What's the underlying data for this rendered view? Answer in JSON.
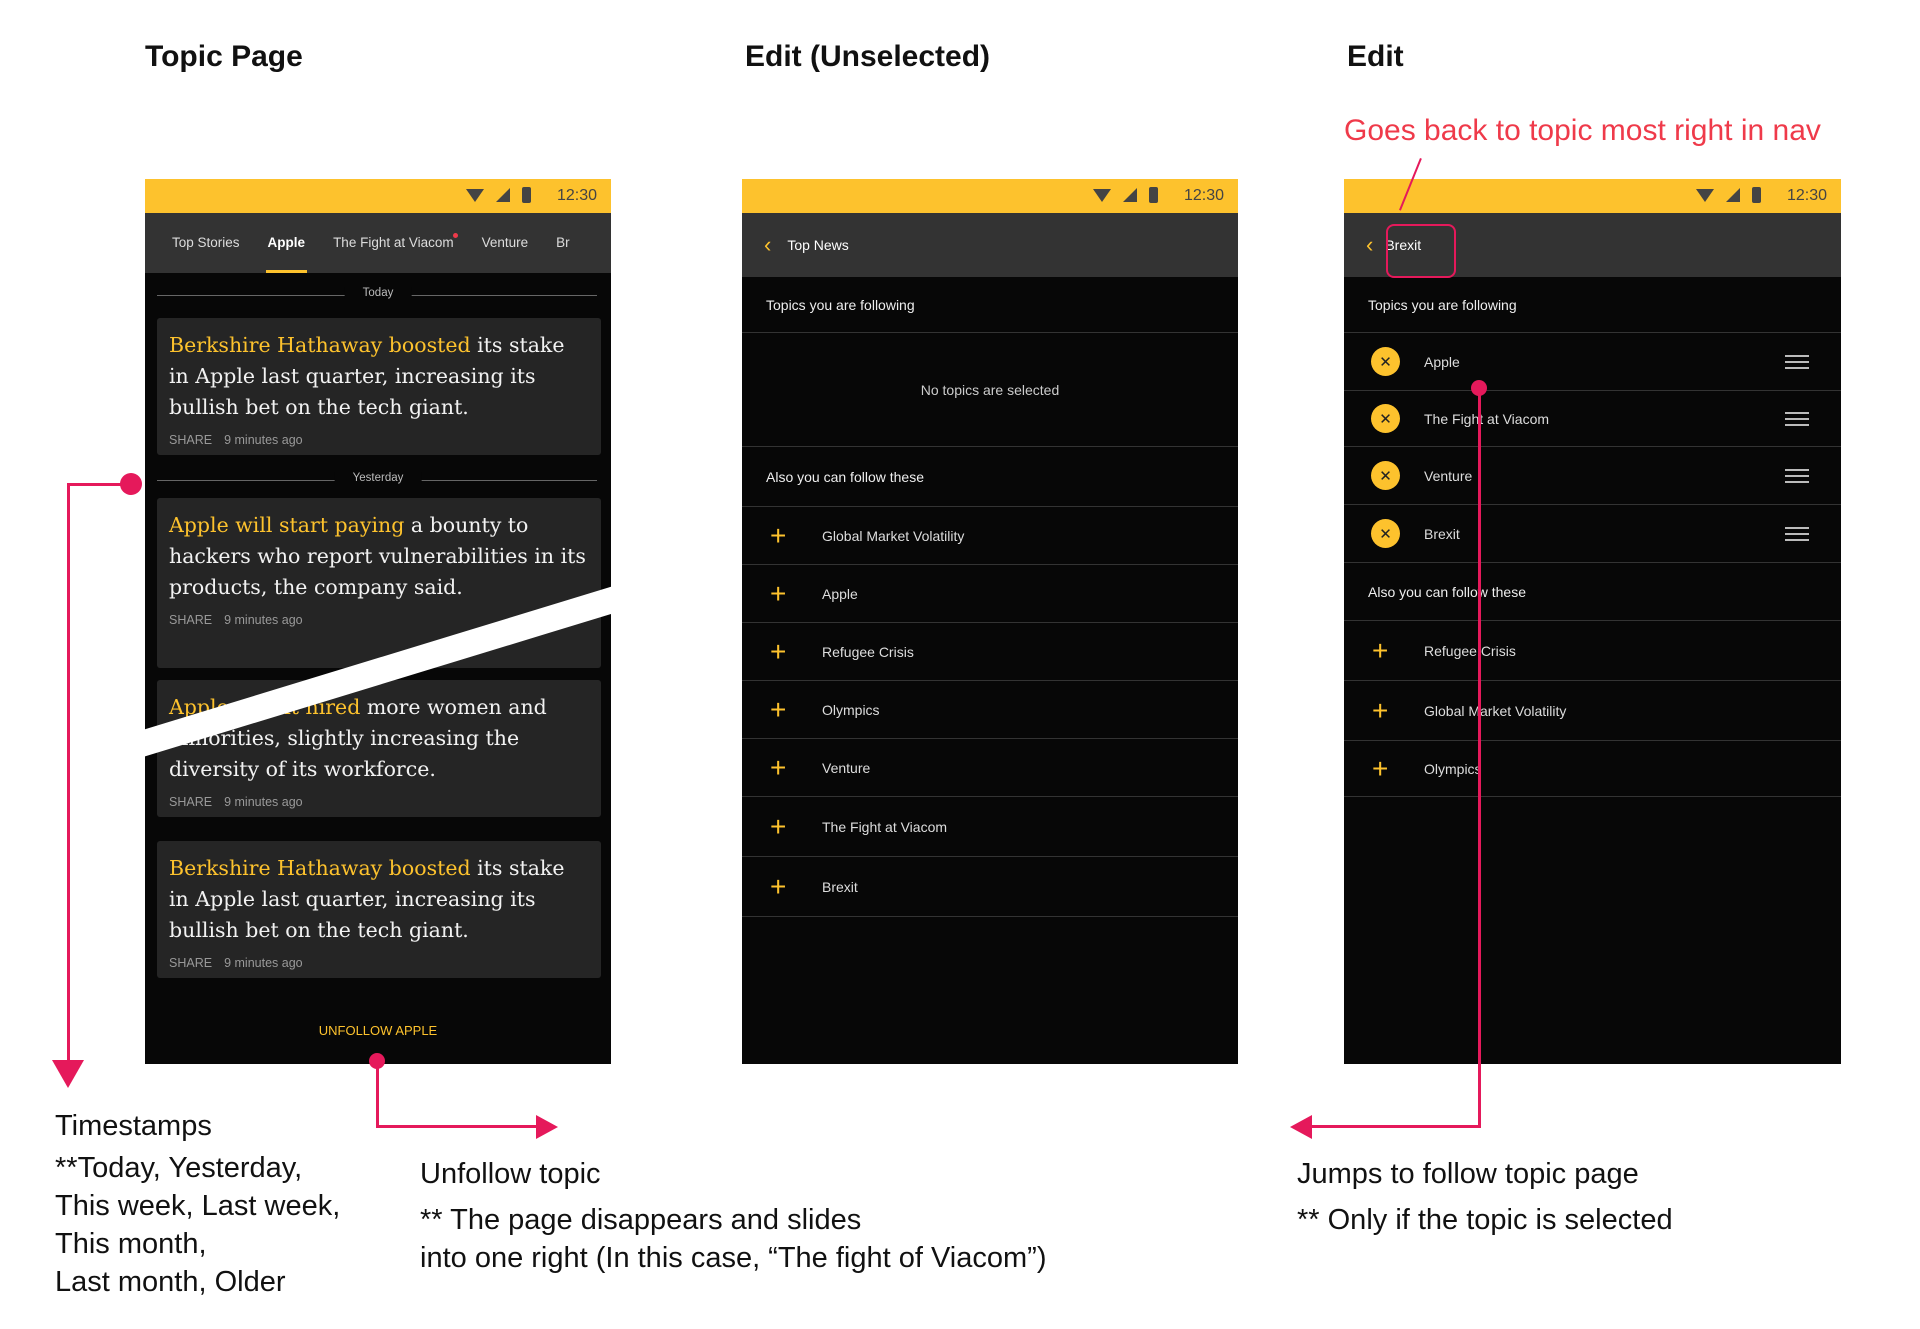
{
  "titles": {
    "topic": "Topic Page",
    "edit_unselected": "Edit (Unselected)",
    "edit": "Edit"
  },
  "status_time": "12:30",
  "topic_page": {
    "tabs": [
      "Top Stories",
      "Apple",
      "The Fight at Viacom",
      "Venture",
      "Br"
    ],
    "active_tab": "Apple",
    "dividers": {
      "today": "Today",
      "yesterday": "Yesterday"
    },
    "cards": [
      {
        "highlight": "Berkshire Hathaway boosted",
        "text": " its stake in Apple last quarter, increasing its bullish bet on the tech giant.",
        "share": "SHARE",
        "time": "9 minutes ago"
      },
      {
        "highlight": "Apple will start paying",
        "text": " a bounty to hackers who report vulnerabilities in its products, the company said.",
        "share": "SHARE",
        "time": "9 minutes ago"
      },
      {
        "highlight": "Apple said it hired",
        "text": " more women and minorities, slightly increasing the diversity of its workforce.",
        "share": "SHARE",
        "time": "9 minutes ago"
      },
      {
        "highlight": "Berkshire Hathaway boosted",
        "text": " its stake in Apple last quarter, increasing its bullish bet on the tech giant.",
        "share": "SHARE",
        "time": "9 minutes ago"
      }
    ],
    "unfollow": "UNFOLLOW APPLE"
  },
  "edit_unselected": {
    "header": "Top News",
    "following_label": "Topics you are following",
    "empty": "No topics are selected",
    "also_label": "Also you can follow these",
    "topics": [
      "Global Market Volatility",
      "Apple",
      "Refugee Crisis",
      "Olympics",
      "Venture",
      "The Fight at Viacom",
      "Brexit"
    ]
  },
  "edit": {
    "header": "Brexit",
    "following_label": "Topics you are following",
    "following": [
      "Apple",
      "The Fight at Viacom",
      "Venture",
      "Brexit"
    ],
    "also_label": "Also you can follow these",
    "topics": [
      "Refugee Crisis",
      "Global Market Volatility",
      "Olympics"
    ]
  },
  "annotations": {
    "goes_back": "Goes back to topic most right in nav",
    "timestamps_title": "Timestamps",
    "timestamps_lines": [
      "**Today, Yesterday,",
      "This week, Last week,",
      "This month,",
      "Last month, Older"
    ],
    "unfollow_title": "Unfollow topic",
    "unfollow_lines": [
      "** The page disappears and slides",
      "into one right (In this case, “The fight of Viacom”)"
    ],
    "jumps_title": "Jumps to follow topic page",
    "jumps_line": "** Only if the topic is selected"
  },
  "colors": {
    "accent": "#fdc22d",
    "annotation_red": "#e5195b",
    "background_dark": "#070707",
    "nav_gray": "#333333"
  }
}
